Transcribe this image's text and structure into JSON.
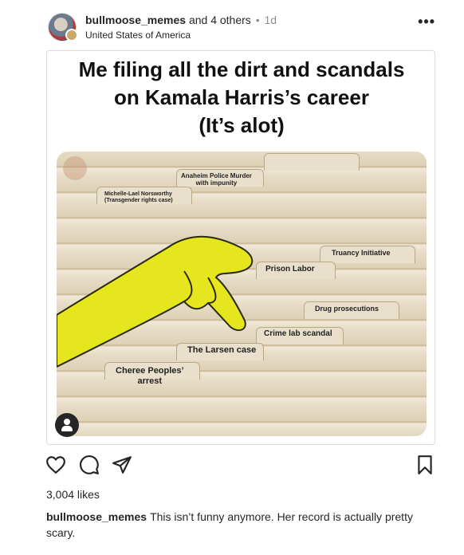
{
  "header": {
    "author": "bullmoose_memes",
    "others": "and 4 others",
    "separator": "•",
    "time": "1d",
    "location": "United States of America",
    "more": "•••"
  },
  "meme": {
    "title_lines": [
      "Me filing all the dirt and scandals",
      "on Kamala Harris’s career",
      "(It’s alot)"
    ],
    "file_labels": [
      "Anaheim Police Murder\nwith impunity",
      "Michelle-Lael Norsworthy\n(Transgender rights case)",
      "Truancy Initiative",
      "Prison Labor",
      "Drug prosecutions",
      "Crime lab scandal",
      "The Larsen case",
      "Cheree Peoples’\narrest"
    ]
  },
  "actions": {
    "like_icon": "heart-icon",
    "comment_icon": "comment-icon",
    "share_icon": "send-icon",
    "save_icon": "bookmark-icon"
  },
  "likes": "3,004 likes",
  "caption": {
    "author": "bullmoose_memes",
    "text": "This isn’t funny anymore. Her record is actually pretty scary."
  }
}
